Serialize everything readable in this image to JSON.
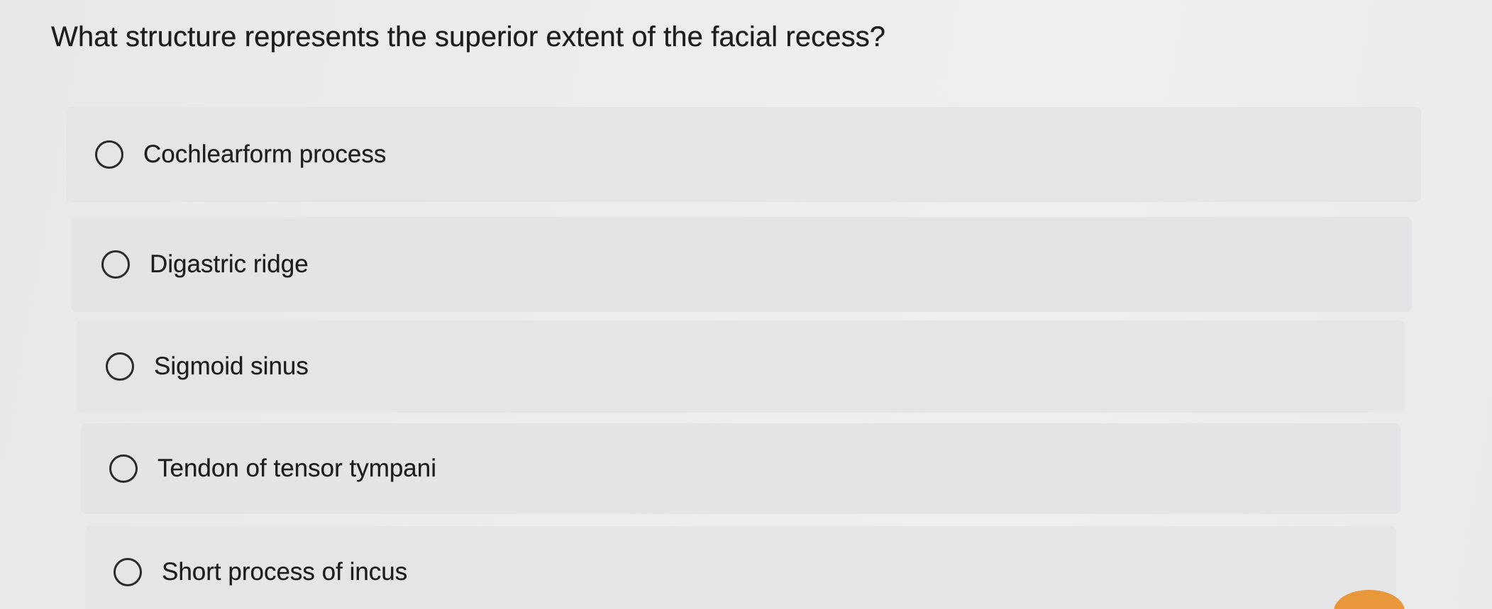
{
  "question": {
    "text": "What structure represents the superior extent of the facial recess?"
  },
  "options": [
    {
      "label": "Cochlearform process",
      "selected": false
    },
    {
      "label": "Digastric ridge",
      "selected": false
    },
    {
      "label": "Sigmoid sinus",
      "selected": false
    },
    {
      "label": "Tendon of tensor tympani",
      "selected": false
    },
    {
      "label": "Short process of incus",
      "selected": false
    }
  ],
  "colors": {
    "background": "#eceeee",
    "option_background": "#e3e5e6",
    "text": "#1d1e20",
    "accent_orange": "#e8973a"
  }
}
